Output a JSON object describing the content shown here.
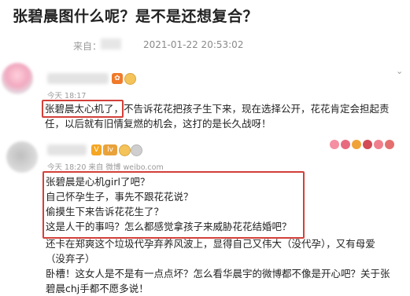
{
  "headline": "张碧晨图什么呢？是不是还想复合？",
  "meta": {
    "from_label": "来自：",
    "datetime": "2021-01-22 20:53:02"
  },
  "comment1": {
    "time": "今天 18:17",
    "line1_boxed": "张碧晨太心机了，",
    "line1_rest": "不告诉花花把孩子生下来，现在选择公开，花花肯定会担起责",
    "line2": "任，以后就有旧情复燃的机会，这打的是长久战呀！"
  },
  "comment2": {
    "time": "今天 18:20 来自 微博 weibo.com",
    "box_lines": [
      "张碧晨是心机girl了吧？",
      "自己怀孕生子，事先不跟花花说？",
      "偷摸生下来告诉花花生了？",
      "这是人干的事吗？怎么都感觉拿孩子来威胁花花结婚吧？"
    ],
    "after_lines": [
      "还卡在郑爽这个垃圾代孕弃养风波上，显得自己又伟大（没代孕），又有母爱",
      "（没弃子）",
      "卧槽！这女人是不是有一点点坏？怎么看华晨宇的微博都不像是开心吧？关于张",
      "碧晨chj手都不愿多说！"
    ]
  },
  "badges": {
    "v": "V",
    "o": "✿",
    "lv": "lv"
  }
}
